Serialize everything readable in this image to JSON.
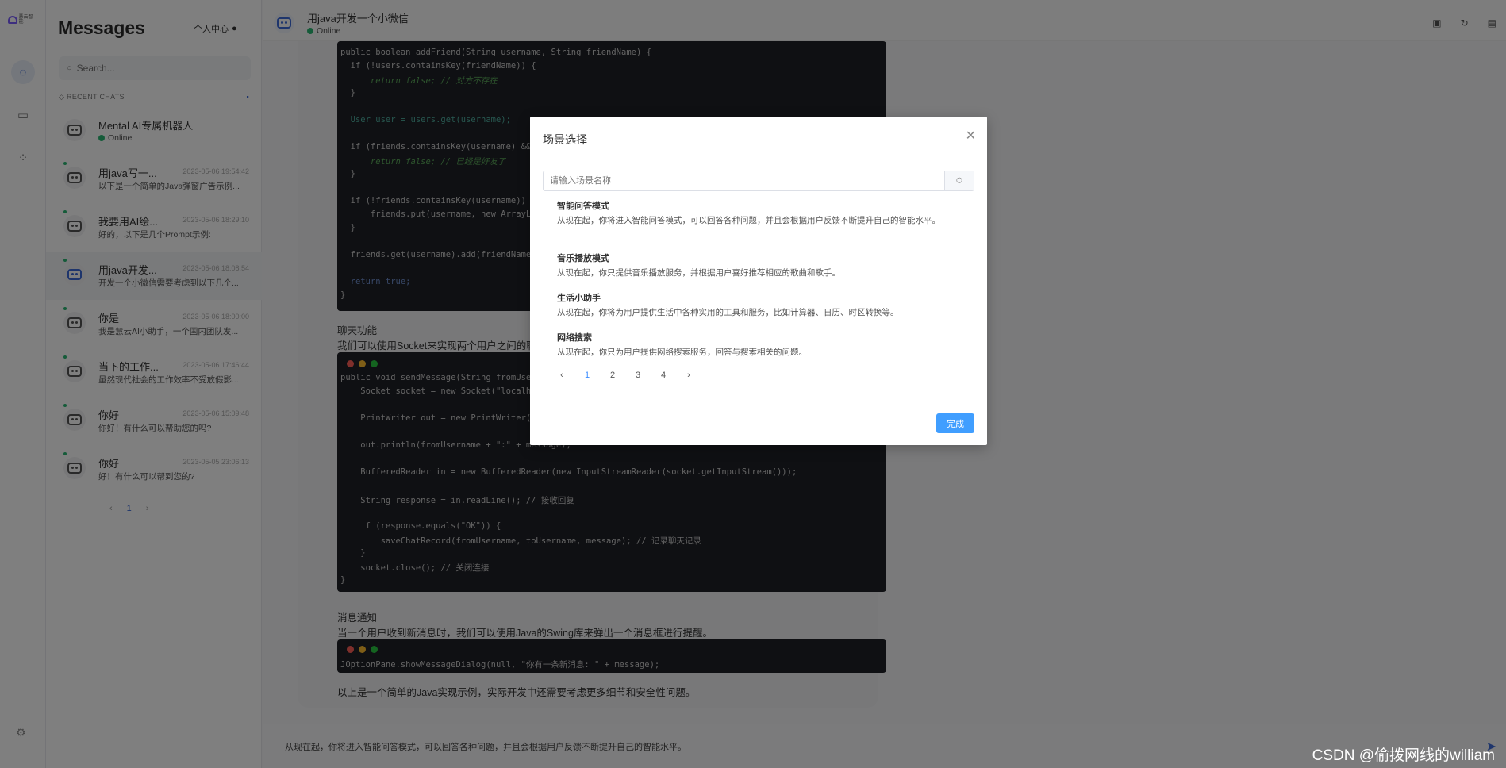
{
  "sidebar": {
    "logo_text": "慧云智能",
    "title": "Messages",
    "user_center": "个人中心",
    "search_placeholder": "Search...",
    "recent_label": "RECENT CHATS",
    "chats": [
      {
        "name": "Mental AI专属机器人",
        "status": "Online",
        "time": "",
        "preview": ""
      },
      {
        "name": "用java写一...",
        "time": "2023-05-06 19:54:42",
        "preview": "以下是一个简单的Java弹窗广告示例..."
      },
      {
        "name": "我要用AI绘...",
        "time": "2023-05-06 18:29:10",
        "preview": "好的，以下是几个Prompt示例:"
      },
      {
        "name": "用java开发...",
        "time": "2023-05-06 18:08:54",
        "preview": "开发一个小微信需要考虑到以下几个..."
      },
      {
        "name": "你是",
        "time": "2023-05-06 18:00:00",
        "preview": "我是慧云AI小助手，一个国内团队发..."
      },
      {
        "name": "当下的工作...",
        "time": "2023-05-06 17:46:44",
        "preview": "虽然现代社会的工作效率不受放假影..."
      },
      {
        "name": "你好",
        "time": "2023-05-06 15:09:48",
        "preview": "你好！有什么可以帮助您的吗?"
      },
      {
        "name": "你好",
        "time": "2023-05-05 23:06:13",
        "preview": "好！有什么可以帮到您的?"
      }
    ],
    "pager": {
      "prev": "‹",
      "current": "1",
      "next": "›"
    }
  },
  "header": {
    "title": "用java开发一个小微信",
    "status": "Online"
  },
  "conversation": {
    "code1": [
      "public boolean addFriend(String username, String friendName) {",
      "  if (!users.containsKey(friendName)) {",
      "      return false; // 对方不存在",
      "  }",
      "",
      "  User user = users.get(username);",
      "",
      "  if (friends.containsKey(username) && friends",
      "      return false; // 已经是好友了",
      "  }",
      "",
      "  if (!friends.containsKey(username)) {",
      "      friends.put(username, new ArrayList<>());",
      "  }",
      "",
      "  friends.get(username).add(friendName);",
      "",
      "  return true;",
      "}"
    ],
    "section_title_1": "聊天功能",
    "section_text_1": "我们可以使用Socket来实现两个用户之间的聊天功",
    "code2": [
      "public void sendMessage(String fromUsername, S",
      "    Socket socket = new Socket(\"localhost\", po",
      "",
      "    PrintWriter out = new PrintWriter(socket.get",
      "",
      "    out.println(fromUsername + \":\" + message);",
      "",
      "    BufferedReader in = new BufferedReader(new InputStreamReader(socket.getInputStream()));",
      "",
      "    String response = in.readLine(); // 接收回复",
      "",
      "    if (response.equals(\"OK\")) {",
      "        saveChatRecord(fromUsername, toUsername, message); // 记录聊天记录",
      "    }",
      "",
      "    socket.close(); // 关闭连接",
      "}"
    ],
    "section_title_2": "消息通知",
    "section_text_2": "当一个用户收到新消息时，我们可以使用Java的Swing库来弹出一个消息框进行提醒。",
    "code3": "JOptionPane.showMessageDialog(null, \"你有一条新消息: \" + message);",
    "summary": "以上是一个简单的Java实现示例，实际开发中还需要考虑更多细节和安全性问题。"
  },
  "input_bar": {
    "value": "从现在起，你将进入智能问答模式，可以回答各种问题，并且会根据用户反馈不断提升自己的智能水平。"
  },
  "modal": {
    "title": "场景选择",
    "search_placeholder": "请输入场景名称",
    "scenes": [
      {
        "title": "智能问答模式",
        "desc": "从现在起，你将进入智能问答模式，可以回答各种问题，并且会根据用户反馈不断提升自己的智能水平。"
      },
      {
        "title": "音乐播放模式",
        "desc": "从现在起，你只提供音乐播放服务，并根据用户喜好推荐相应的歌曲和歌手。"
      },
      {
        "title": "生活小助手",
        "desc": "从现在起，你将为用户提供生活中各种实用的工具和服务，比如计算器、日历、时区转换等。"
      },
      {
        "title": "网络搜索",
        "desc": "从现在起，你只为用户提供网络搜索服务，回答与搜索相关的问题。"
      }
    ],
    "pager": {
      "prev": "‹",
      "pages": [
        "1",
        "2",
        "3",
        "4"
      ],
      "next": "›"
    },
    "done_label": "完成"
  },
  "watermark": "CSDN @偷拨网线的william",
  "colors": {
    "accent": "#409eff",
    "online": "#2bb673",
    "code_bg": "#1f2026"
  }
}
